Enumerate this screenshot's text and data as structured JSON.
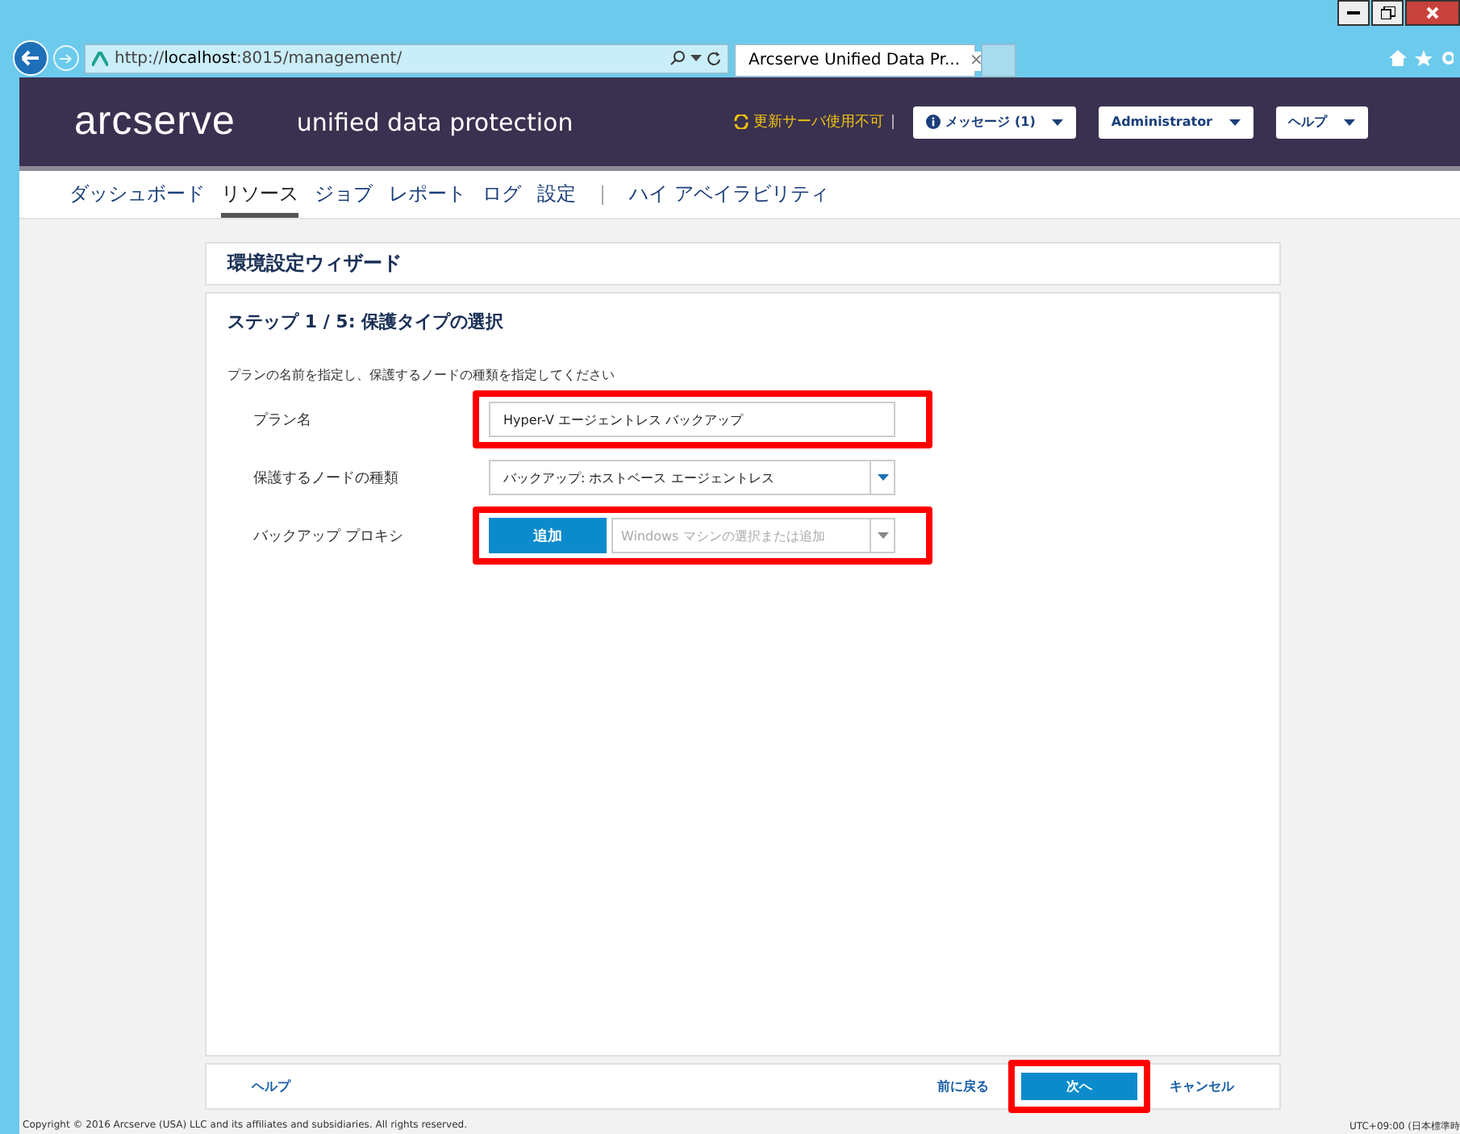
{
  "browser": {
    "url_prefix": "http://",
    "url_host": "localhost",
    "url_rest": ":8015/management/",
    "tab_title": "Arcserve Unified Data Pr...",
    "tab_close": "×"
  },
  "header": {
    "logo": "arcserve",
    "tagline": "unified data protection",
    "warning": "更新サーバ使用不可",
    "buttons": [
      {
        "label": "メッセージ (1)",
        "kind": "info"
      },
      {
        "label": "Administrator",
        "kind": "plain"
      },
      {
        "label": "ヘルプ",
        "kind": "plain"
      }
    ]
  },
  "nav": [
    {
      "label": "ダッシュボード",
      "selected": false
    },
    {
      "label": "リソース",
      "selected": true
    },
    {
      "label": "ジョブ",
      "selected": false
    },
    {
      "label": "レポート",
      "selected": false
    },
    {
      "label": "ログ",
      "selected": false
    },
    {
      "label": "設定",
      "selected": false
    },
    {
      "label": "ハイ アベイラビリティ",
      "selected": false,
      "separated": true
    }
  ],
  "wizard": {
    "title": "環境設定ウィザード",
    "step_title": "ステップ 1 / 5: 保護タイプの選択",
    "instruction": "プランの名前を指定し、保護するノードの種類を指定してください",
    "fields": [
      {
        "label": "プラン名",
        "kind": "text",
        "value": "Hyper-V エージェントレス バックアップ",
        "highlighted": true
      },
      {
        "label": "保護するノードの種類",
        "kind": "select",
        "value": "バックアップ: ホストベース エージェントレス",
        "highlighted": false
      },
      {
        "label": "バックアップ プロキシ",
        "kind": "combo",
        "button": "追加",
        "placeholder": "Windows マシンの選択または追加",
        "highlighted": true
      }
    ],
    "footer": {
      "help": "ヘルプ",
      "back": "前に戻る",
      "next": "次へ",
      "cancel": "キャンセル",
      "next_highlighted": true
    }
  },
  "status": {
    "copyright": "Copyright © 2016 Arcserve (USA) LLC and its affiliates and subsidiaries. All rights reserved.",
    "timezone": "UTC+09:00 (日本標準時"
  }
}
